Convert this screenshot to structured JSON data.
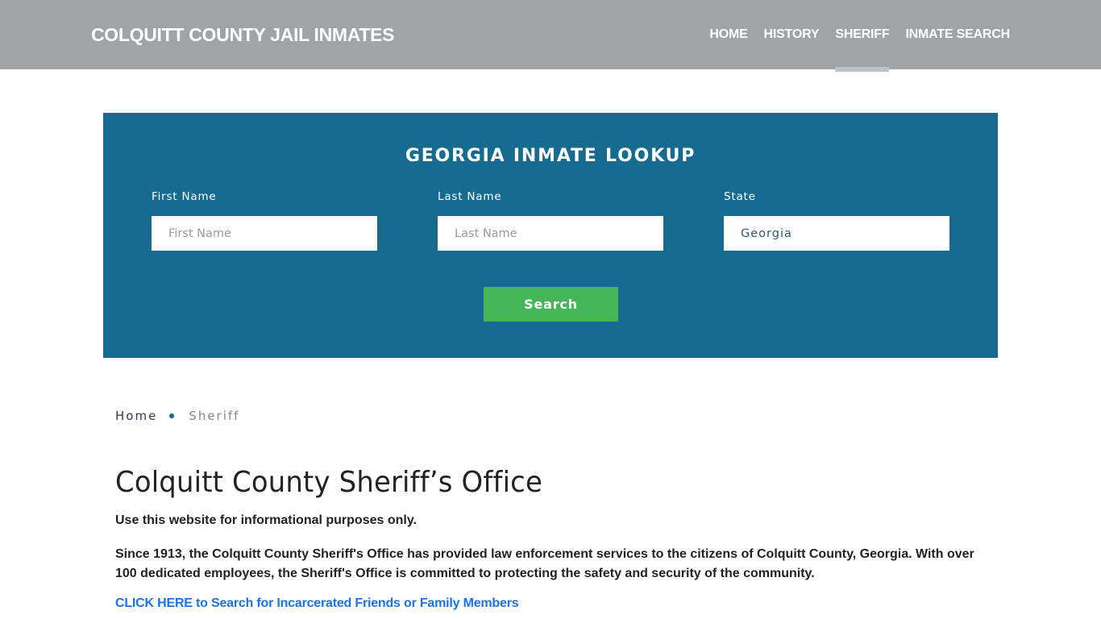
{
  "header": {
    "brand": "COLQUITT COUNTY JAIL INMATES",
    "nav": [
      {
        "label": "HOME",
        "active": false
      },
      {
        "label": "HISTORY",
        "active": false
      },
      {
        "label": "SHERIFF",
        "active": true
      },
      {
        "label": "INMATE SEARCH",
        "active": false
      }
    ]
  },
  "lookup": {
    "title": "GEORGIA INMATE LOOKUP",
    "first_name": {
      "label": "First Name",
      "placeholder": "First Name",
      "value": ""
    },
    "last_name": {
      "label": "Last Name",
      "placeholder": "Last Name",
      "value": ""
    },
    "state": {
      "label": "State",
      "value": "Georgia"
    },
    "search_label": "Search",
    "colors": {
      "panel": "#176b8e",
      "button": "#44b658"
    }
  },
  "breadcrumb": {
    "home": "Home",
    "current": "Sheriff"
  },
  "content": {
    "title": "Colquitt County Sheriff’s Office",
    "intro": "Use this website for informational purposes only.",
    "body": "Since 1913, the Colquitt County Sheriff's Office has provided law enforcement services to the citizens of Colquitt County, Georgia. With over 100 dedicated employees, the Sheriff's Office is committed to protecting the safety and security of the community.",
    "cta": "CLICK HERE to Search for Incarcerated Friends or Family Members",
    "link_color": "#1a73e8"
  }
}
